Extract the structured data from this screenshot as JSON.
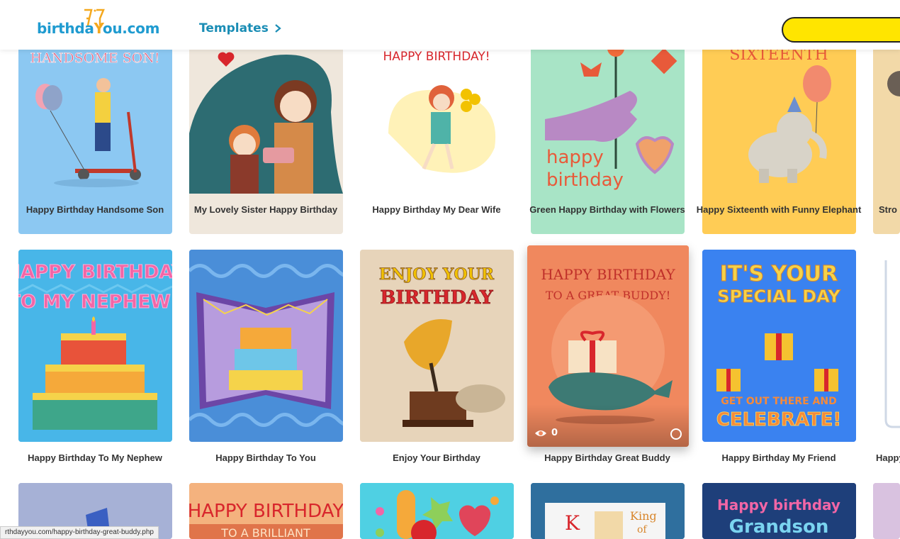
{
  "header": {
    "logo_text_a": "birthda",
    "logo_text_b": "Y",
    "logo_text_c": "ou.com",
    "nav_templates": "Templates"
  },
  "cards": [
    {
      "title": "Happy Birthday Handsome Son",
      "art_text": "HANDSOME SON!"
    },
    {
      "title": "My Lovely Sister Happy Birthday",
      "art_text": ""
    },
    {
      "title": "Happy Birthday My Dear Wife",
      "art_text": "HAPPY BIRTHDAY!"
    },
    {
      "title": "Green Happy Birthday with Flowers",
      "art_text_1": "happy",
      "art_text_2": "birthday"
    },
    {
      "title": "Happy Sixteenth with Funny Elephant",
      "art_text": "SIXTEENTH"
    },
    {
      "title": "Stro",
      "art_text": ""
    },
    {
      "title": "Happy Birthday To My Nephew",
      "art_text_1": "HAPPY BIRTHDAY",
      "art_text_2": "TO MY NEPHEW"
    },
    {
      "title": "Happy Birthday To You",
      "art_text": ""
    },
    {
      "title": "Enjoy Your Birthday",
      "art_text_1": "ENJOY YOUR",
      "art_text_2": "BIRTHDAY"
    },
    {
      "title": "Happy Birthday Great Buddy",
      "art_text_1": "HAPPY BIRTHDAY",
      "art_text_2": "TO A GREAT BUDDY!",
      "views": "0"
    },
    {
      "title": "Happy Birthday My Friend",
      "art_text_1": "IT'S YOUR",
      "art_text_2": "SPECIAL DAY",
      "art_text_3": "GET OUT THERE AND",
      "art_text_4": "CELEBRATE!"
    },
    {
      "title": "Happy",
      "art_text": ""
    },
    {
      "title": "",
      "art_text": ""
    },
    {
      "title": "",
      "art_text_1": "HAPPY BIRTHDAY",
      "art_text_2": "TO A BRILLIANT"
    },
    {
      "title": "",
      "art_text": ""
    },
    {
      "title": "",
      "art_text_1": "King",
      "art_text_2": "of",
      "art_text_3": "K"
    },
    {
      "title": "",
      "art_text_1": "Happy birthday",
      "art_text_2": "Grandson"
    }
  ],
  "status_url": "rthdayyou.com/happy-birthday-great-buddy.php",
  "colors": {
    "accent": "#1a8db5",
    "search": "#ffe500"
  }
}
